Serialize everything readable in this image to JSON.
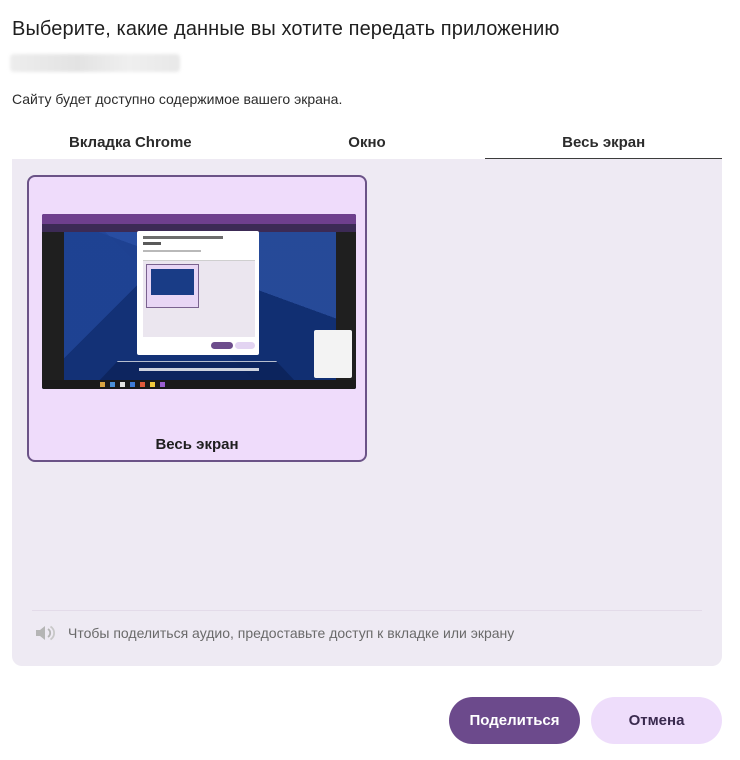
{
  "dialog": {
    "title": "Выберите, какие данные вы хотите передать приложению",
    "subtitle": "Сайту будет доступно содержимое вашего экрана."
  },
  "tabs": [
    {
      "label": "Вкладка Chrome",
      "active": false
    },
    {
      "label": "Окно",
      "active": false
    },
    {
      "label": "Весь экран",
      "active": true
    }
  ],
  "sources": [
    {
      "label": "Весь экран",
      "selected": true
    }
  ],
  "audio": {
    "icon": "speaker-muted-icon",
    "text": "Чтобы поделиться аудио, предоставьте доступ к вкладке или экрану"
  },
  "buttons": {
    "share_label": "Поделиться",
    "cancel_label": "Отмена"
  },
  "colors": {
    "accent": "#6c4a8c",
    "secondary_button": "#eeddfb",
    "panel_bg": "#eeeaf3",
    "card_selected_bg": "#efdcfb",
    "card_selected_border": "#6b5387"
  }
}
